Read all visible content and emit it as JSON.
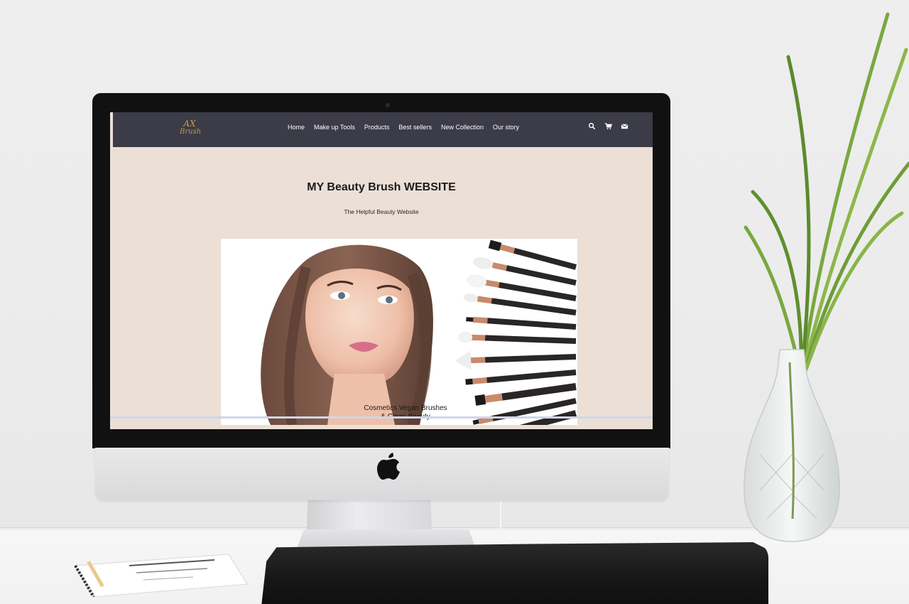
{
  "site": {
    "brand": {
      "line1": "AX",
      "line2": "Brush"
    },
    "nav": {
      "links": [
        {
          "label": "Home"
        },
        {
          "label": "Make up Tools"
        },
        {
          "label": "Products"
        },
        {
          "label": "Best sellers"
        },
        {
          "label": "New Collection"
        },
        {
          "label": "Our story"
        }
      ],
      "icons": [
        "search-icon",
        "cart-icon",
        "mail-icon"
      ]
    },
    "hero": {
      "title": "MY Beauty Brush WEBSITE",
      "subtitle": "The Helpful Beauty Website"
    },
    "banner": {
      "caption_line1": "Cosmetics Vegan Brushes",
      "caption_line2": "& Clean Beauty"
    }
  },
  "colors": {
    "navbar": "#3c3b48",
    "page_background": "#ebdfd6",
    "brand_gold": "#c29c3f",
    "nav_text": "#ffffff"
  }
}
